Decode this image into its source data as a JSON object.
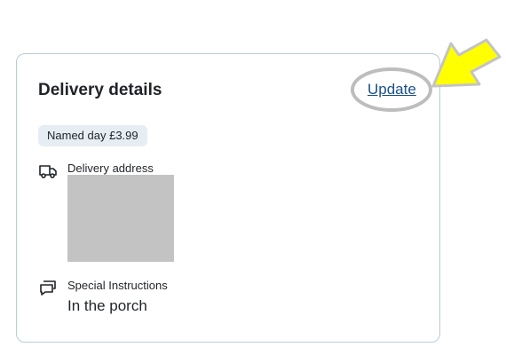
{
  "card": {
    "title": "Delivery details",
    "update_label": "Update",
    "badge": "Named day £3.99",
    "delivery_address_label": "Delivery address",
    "special_instructions_label": "Special Instructions",
    "special_instructions_value": "In the porch"
  },
  "icons": {
    "delivery": "truck-icon",
    "instructions": "chat-bubbles-icon"
  },
  "colors": {
    "link": "#1a4f8a",
    "card_border": "#b9ccd6",
    "badge_bg": "#e6eef4",
    "highlight_arrow": "#ffff00",
    "highlight_circle": "#bdbdbd"
  }
}
